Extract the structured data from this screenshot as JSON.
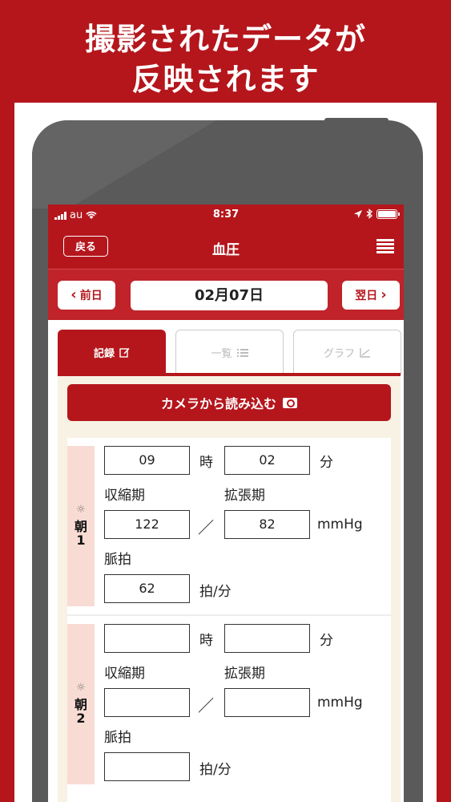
{
  "banner": {
    "line1": "撮影されたデータが",
    "line2": "反映されます"
  },
  "status": {
    "carrier": "au",
    "time": "8:37",
    "battery_level": 1.0
  },
  "nav": {
    "back": "戻る",
    "title": "血圧"
  },
  "date_bar": {
    "prev": "前日",
    "date": "02月07日",
    "next": "翌日"
  },
  "tabs": [
    {
      "label": "記録",
      "icon": "edit-icon",
      "active": true
    },
    {
      "label": "一覧",
      "icon": "list-icon",
      "active": false
    },
    {
      "label": "グラフ",
      "icon": "graph-icon",
      "active": false
    }
  ],
  "camera_button": "カメラから読み込む",
  "labels": {
    "hour": "時",
    "minute": "分",
    "systolic": "収縮期",
    "diastolic": "拡張期",
    "slash": "／",
    "unit": "mmHg",
    "pulse": "脈拍",
    "pulse_unit": "拍/分"
  },
  "entries": [
    {
      "period": "朝",
      "number": "1",
      "hour": "09",
      "minute": "02",
      "systolic": "122",
      "diastolic": "82",
      "pulse": "62"
    },
    {
      "period": "朝",
      "number": "2",
      "hour": "",
      "minute": "",
      "systolic": "",
      "diastolic": "",
      "pulse": ""
    }
  ],
  "colors": {
    "brand": "#b4161c",
    "label_bg": "#f8dcd4",
    "content_bg": "#f7f2e4"
  }
}
